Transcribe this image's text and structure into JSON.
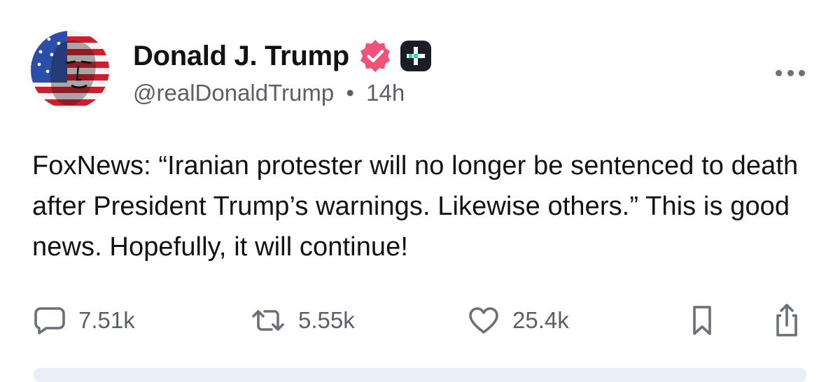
{
  "author": {
    "display_name": "Donald J. Trump",
    "handle": "@realDonaldTrump",
    "separator": "•",
    "time_ago": "14h",
    "verified": true
  },
  "post": {
    "text": "FoxNews: “Iranian protester will no longer be sentenced to death after President Trump’s warnings. Likewise others.” This is good news. Hopefully, it will continue!"
  },
  "actions": {
    "replies": "7.51k",
    "retruths": "5.55k",
    "likes": "25.4k"
  },
  "icons": {
    "avatar": "avatar-flag-portrait",
    "verified": "verified-badge-icon",
    "plus": "truth-plus-icon",
    "more": "more-options-icon",
    "reply": "reply-icon",
    "retruth": "retruth-icon",
    "like": "heart-icon",
    "bookmark": "bookmark-icon",
    "share": "share-icon"
  },
  "colors": {
    "verified_badge": "#F0527A",
    "plus_badge": "#1B1E26",
    "plus_accent": "#2FD6B5",
    "text_primary": "#121214",
    "text_secondary": "#5C5F6B"
  }
}
